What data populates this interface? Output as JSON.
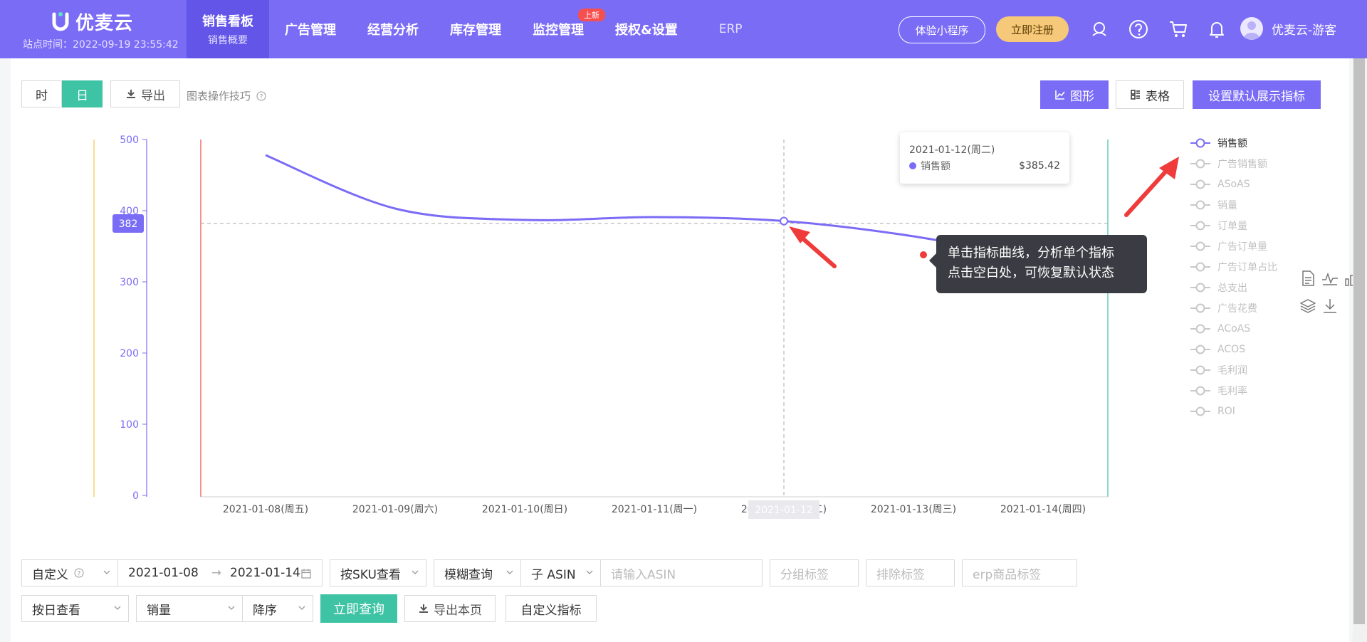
{
  "header": {
    "logo_text": "优麦云",
    "site_time": "站点时间：2022-09-19 23:55:42",
    "nav": [
      {
        "label": "销售看板",
        "sub": "销售概要",
        "active": true
      },
      {
        "label": "广告管理"
      },
      {
        "label": "经营分析"
      },
      {
        "label": "库存管理"
      },
      {
        "label": "监控管理"
      },
      {
        "label": "授权&设置",
        "badge": "上新"
      },
      {
        "label": "ERP"
      }
    ],
    "mini_program": "体验小程序",
    "register": "立即注册",
    "icons": [
      "headset-icon",
      "help-icon",
      "cart-icon",
      "bell-icon"
    ],
    "user_name": "优麦云-游客"
  },
  "toolbar": {
    "hour": "时",
    "day": "日",
    "export": "导出",
    "tip": "图表操作技巧",
    "graph": "图形",
    "table": "表格",
    "set_default": "设置默认展示指标"
  },
  "chart_data": {
    "type": "line",
    "x": [
      "2021-01-08(周五)",
      "2021-01-09(周六)",
      "2021-01-10(周日)",
      "2021-01-11(周一)",
      "2021-01-12(周二)",
      "2021-01-13(周三)",
      "2021-01-14(周四)"
    ],
    "series": [
      {
        "name": "销售额",
        "color": "#7b6cf6",
        "values": [
          478,
          403,
          387,
          391,
          385.42,
          364,
          330
        ]
      }
    ],
    "ylim": [
      0,
      500
    ],
    "yticks": [
      "0",
      "100",
      "200",
      "300",
      "400",
      "500"
    ],
    "reference_line": 382,
    "reference_label": "382",
    "highlight_x_label": "2021-01-12",
    "legend": [
      "销售额",
      "广告销售额",
      "ASoAS",
      "销量",
      "订单量",
      "广告订单量",
      "广告订单占比",
      "总支出",
      "广告花费",
      "ACoAS",
      "ACOS",
      "毛利润",
      "毛利率",
      "ROI"
    ],
    "legend_active": "销售额"
  },
  "tooltip": {
    "date": "2021-01-12(周二)",
    "series": "销售额",
    "value": "$385.42"
  },
  "callout": {
    "line1": "单击指标曲线，分析单个指标",
    "line2": "点击空白处，可恢复默认状态"
  },
  "side_tools": [
    "document-icon",
    "line-chart-icon",
    "bar-chart-icon",
    "layers-icon",
    "download-icon"
  ],
  "filters": {
    "custom": "自定义",
    "date_start": "2021-01-08",
    "date_sep": "→",
    "date_end": "2021-01-14",
    "by_sku": "按SKU查看",
    "fuzzy": "模糊查询",
    "asin_type": "子 ASIN",
    "asin_placeholder": "请输入ASIN",
    "group_tag": "分组标签",
    "exclude_tag": "排除标签",
    "erp_tag": "erp商品标签",
    "by_day": "按日查看",
    "metric": "销量",
    "order": "降序",
    "query": "立即查询",
    "export_page": "导出本页",
    "custom_metric": "自定义指标"
  }
}
